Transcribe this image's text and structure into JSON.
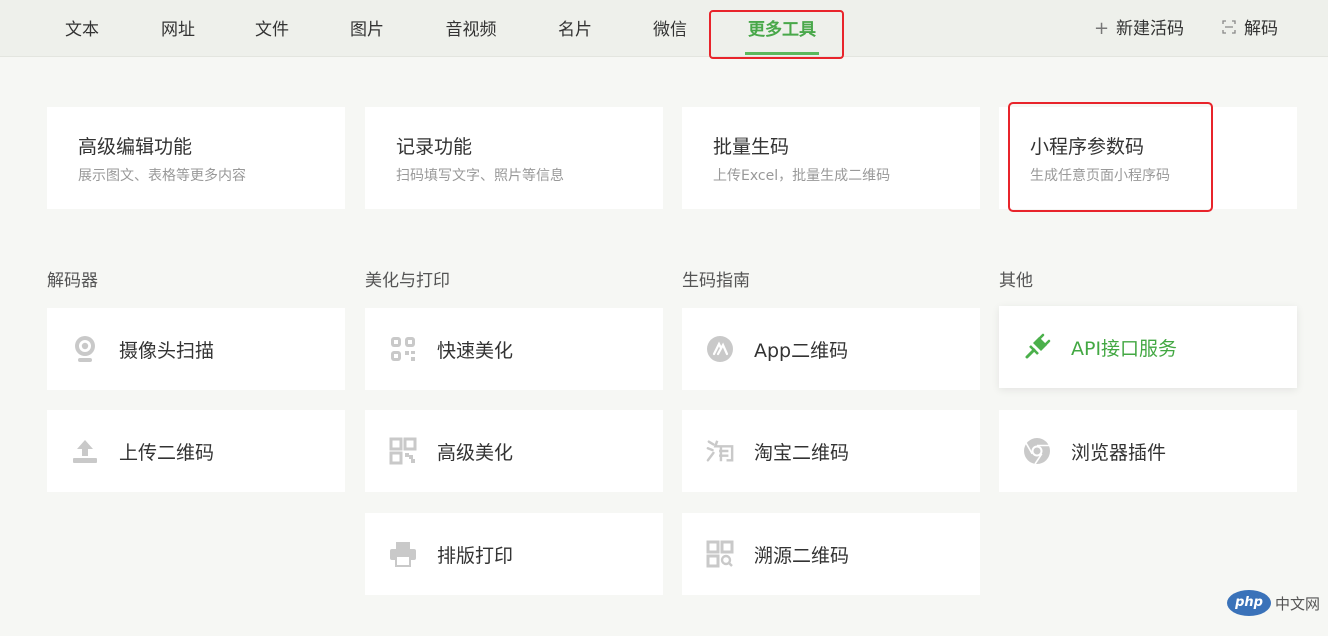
{
  "nav": {
    "tabs": [
      {
        "label": "文本"
      },
      {
        "label": "网址"
      },
      {
        "label": "文件"
      },
      {
        "label": "图片"
      },
      {
        "label": "音视频"
      },
      {
        "label": "名片"
      },
      {
        "label": "微信"
      },
      {
        "label": "更多工具",
        "active": true
      }
    ],
    "new_code": "新建活码",
    "decode": "解码"
  },
  "features": [
    {
      "title": "高级编辑功能",
      "desc": "展示图文、表格等更多内容"
    },
    {
      "title": "记录功能",
      "desc": "扫码填写文字、照片等信息"
    },
    {
      "title": "批量生码",
      "desc": "上传Excel，批量生成二维码"
    },
    {
      "title": "小程序参数码",
      "desc": "生成任意页面小程序码"
    }
  ],
  "sections": {
    "decoder": {
      "title": "解码器",
      "items": [
        {
          "label": "摄像头扫描",
          "icon": "camera-icon"
        },
        {
          "label": "上传二维码",
          "icon": "upload-icon"
        }
      ]
    },
    "beautify": {
      "title": "美化与打印",
      "items": [
        {
          "label": "快速美化",
          "icon": "qr-beautify-icon"
        },
        {
          "label": "高级美化",
          "icon": "qr-advanced-icon"
        },
        {
          "label": "排版打印",
          "icon": "printer-icon"
        }
      ]
    },
    "guide": {
      "title": "生码指南",
      "items": [
        {
          "label": "App二维码",
          "icon": "app-store-icon"
        },
        {
          "label": "淘宝二维码",
          "icon": "taobao-icon"
        },
        {
          "label": "溯源二维码",
          "icon": "trace-qr-icon"
        }
      ]
    },
    "other": {
      "title": "其他",
      "items": [
        {
          "label": "API接口服务",
          "icon": "plug-icon"
        },
        {
          "label": "浏览器插件",
          "icon": "browser-icon"
        }
      ]
    }
  },
  "colors": {
    "accent": "#49a84a",
    "highlight": "#e8242b"
  },
  "watermark": {
    "logo": "php",
    "text": "中文网"
  }
}
